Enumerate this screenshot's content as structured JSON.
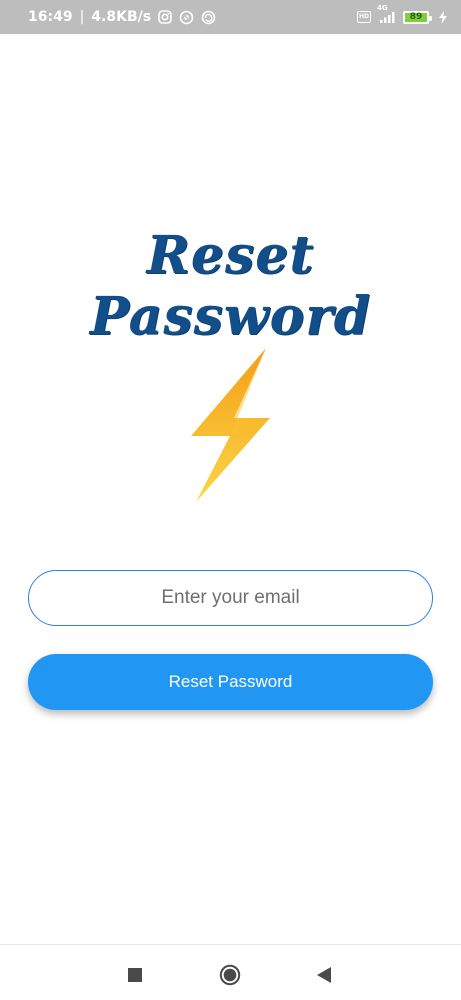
{
  "status_bar": {
    "time": "16:49",
    "speed": "4.8KB/s",
    "network": "4G",
    "battery": "89",
    "icons": [
      "instagram-icon",
      "vpn-icon",
      "sync-icon",
      "hd-icon",
      "signal-icon",
      "battery-icon",
      "charging-icon"
    ]
  },
  "page": {
    "title": "Reset Password",
    "logo": "lightning-bolt-icon"
  },
  "form": {
    "email_placeholder": "Enter your email",
    "email_value": "",
    "submit_label": "Reset Password"
  },
  "colors": {
    "title": "#124e8a",
    "button": "#2196f3",
    "input_border": "#2f7fe0",
    "bolt_top": "#f59e16",
    "bolt_bottom": "#fbd648",
    "status_bar": "#bdbdbd"
  },
  "nav_bar": {
    "buttons": [
      "recents-button",
      "home-button",
      "back-button"
    ]
  }
}
